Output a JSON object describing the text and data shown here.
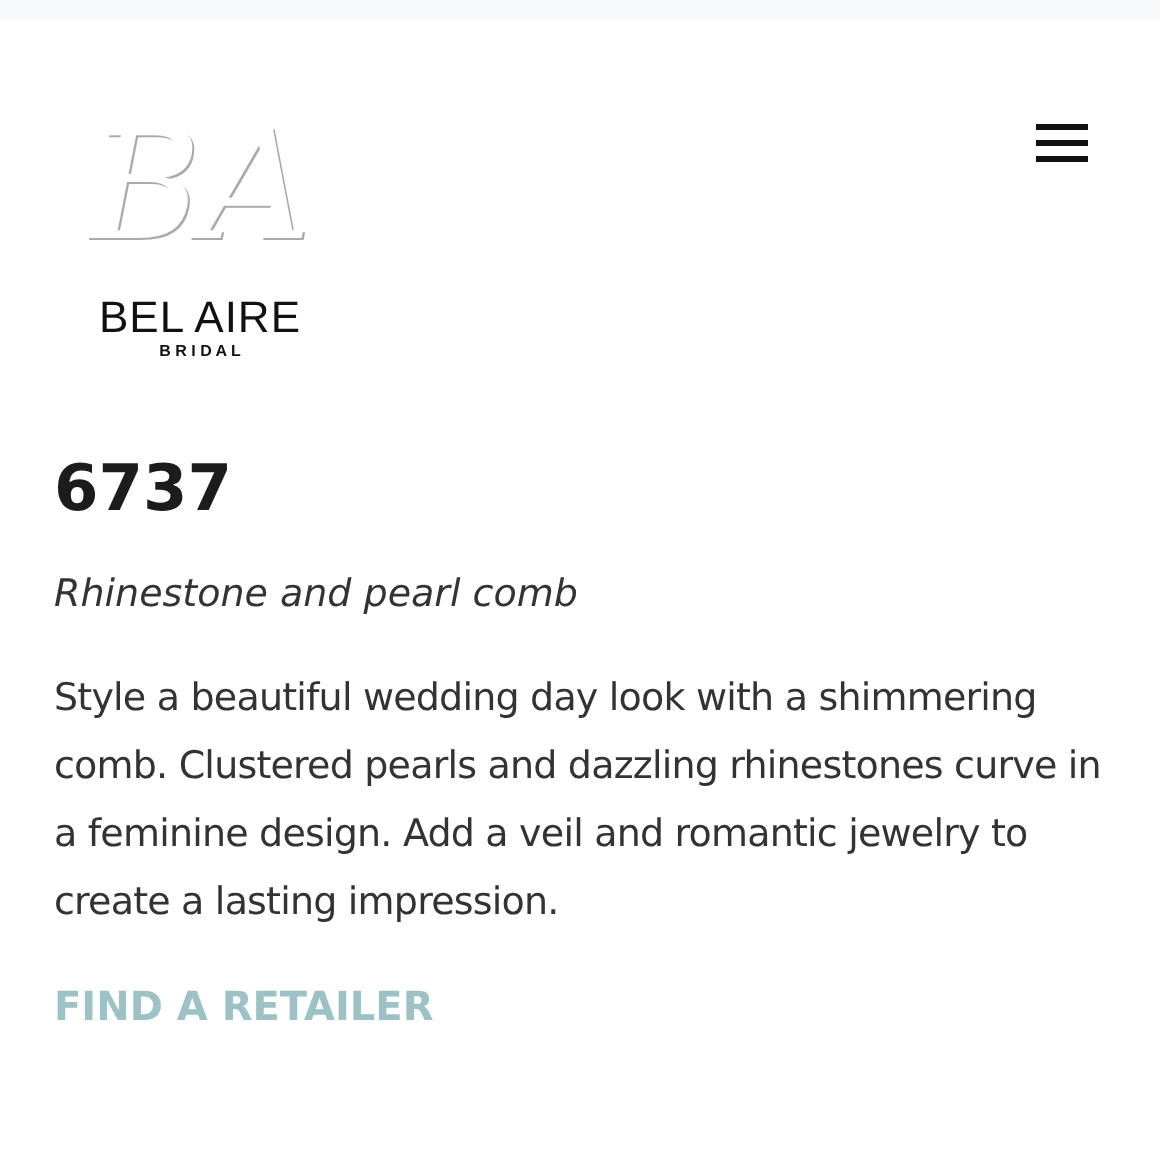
{
  "logo": {
    "monogram": "BA",
    "name": "BEL AIRE",
    "tagline": "B R I D A L"
  },
  "product": {
    "title": "6737",
    "subtitle": "Rhinestone and pearl comb",
    "description": "Style a beautiful wedding day look with a shimmering comb. Clustered pearls and dazzling rhinestones curve in a feminine design. Add a veil and romantic jewelry to create a lasting impression.",
    "link": "FIND A RETAILER"
  }
}
